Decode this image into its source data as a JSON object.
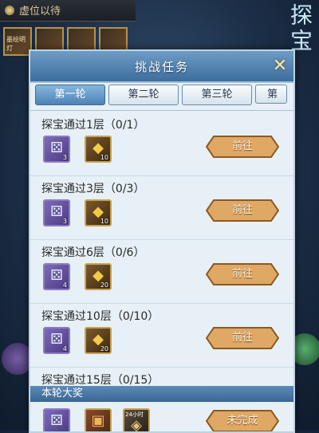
{
  "background": {
    "topbar_text": "虚位以待",
    "side_title": "探宝",
    "icon_caption": "墨绘明灯"
  },
  "dialog": {
    "title": "挑战任务",
    "close_icon": "close-icon"
  },
  "tabs": [
    {
      "label": "第一轮",
      "active": true
    },
    {
      "label": "第二轮",
      "active": false
    },
    {
      "label": "第三轮",
      "active": false
    },
    {
      "label": "第",
      "active": false
    }
  ],
  "tasks": [
    {
      "title": "探宝通过1层（0/1）",
      "rewards": [
        {
          "type": "dice",
          "qty": "3"
        },
        {
          "type": "gold",
          "qty": "10"
        }
      ],
      "button": "前往"
    },
    {
      "title": "探宝通过3层（0/3）",
      "rewards": [
        {
          "type": "dice",
          "qty": "3"
        },
        {
          "type": "gold",
          "qty": "10"
        }
      ],
      "button": "前往"
    },
    {
      "title": "探宝通过6层（0/6）",
      "rewards": [
        {
          "type": "dice",
          "qty": "4"
        },
        {
          "type": "gold",
          "qty": "20"
        }
      ],
      "button": "前往"
    },
    {
      "title": "探宝通过10层（0/10）",
      "rewards": [
        {
          "type": "dice",
          "qty": "4"
        },
        {
          "type": "gold",
          "qty": "20"
        }
      ],
      "button": "前往"
    },
    {
      "title": "探宝通过15层（0/15）"
    }
  ],
  "round_reward": {
    "header": "本轮大奖",
    "timer_label": "24小时",
    "button": "未完成"
  },
  "colors": {
    "button_fill": "#e0a865",
    "button_stroke": "#8a5a22"
  }
}
